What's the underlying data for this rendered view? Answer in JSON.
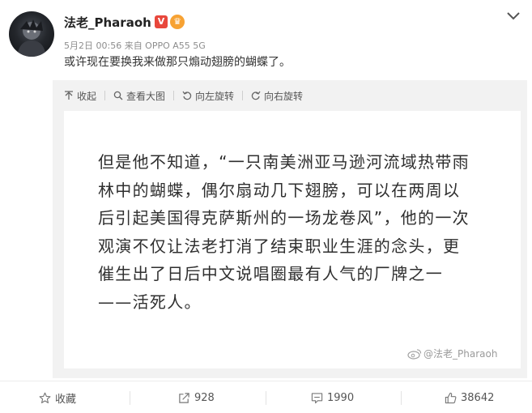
{
  "header": {
    "username": "法老_Pharaoh",
    "verified_badge": "V",
    "meta": "5月2日 00:56 来自 OPPO A55 5G",
    "post_text": "或许现在要换我来做那只煽动翅膀的蝴蝶了。"
  },
  "toolbar": {
    "collapse": "收起",
    "view_large": "查看大图",
    "rotate_left": "向左旋转",
    "rotate_right": "向右旋转"
  },
  "image": {
    "lines": [
      "但是他不知道，“一只南美洲亚马逊河流域热带雨",
      "林中的蝴蝶，偶尔扇动几下翅膀，可以在两周以",
      "后引起美国得克萨斯州的一场龙卷风”，他的一次",
      "观演不仅让法老打消了结束职业生涯的念头，更",
      "催生出了日后中文说唱圈最有人气的厂牌之一",
      "——活死人。"
    ],
    "watermark": "@法老_Pharaoh"
  },
  "actions": {
    "favorite": "收藏",
    "repost": "928",
    "comment": "1990",
    "like": "38642"
  },
  "icons": [
    "more-icon",
    "arrow-up-icon",
    "search-icon",
    "rotate-left-icon",
    "rotate-right-icon",
    "star-icon",
    "share-icon",
    "comment-icon",
    "thumbs-up-icon",
    "weibo-logo-icon"
  ],
  "colors": {
    "badge": "#e8473c",
    "medal": "#f7a233",
    "media_bg": "#f2f2f2"
  }
}
